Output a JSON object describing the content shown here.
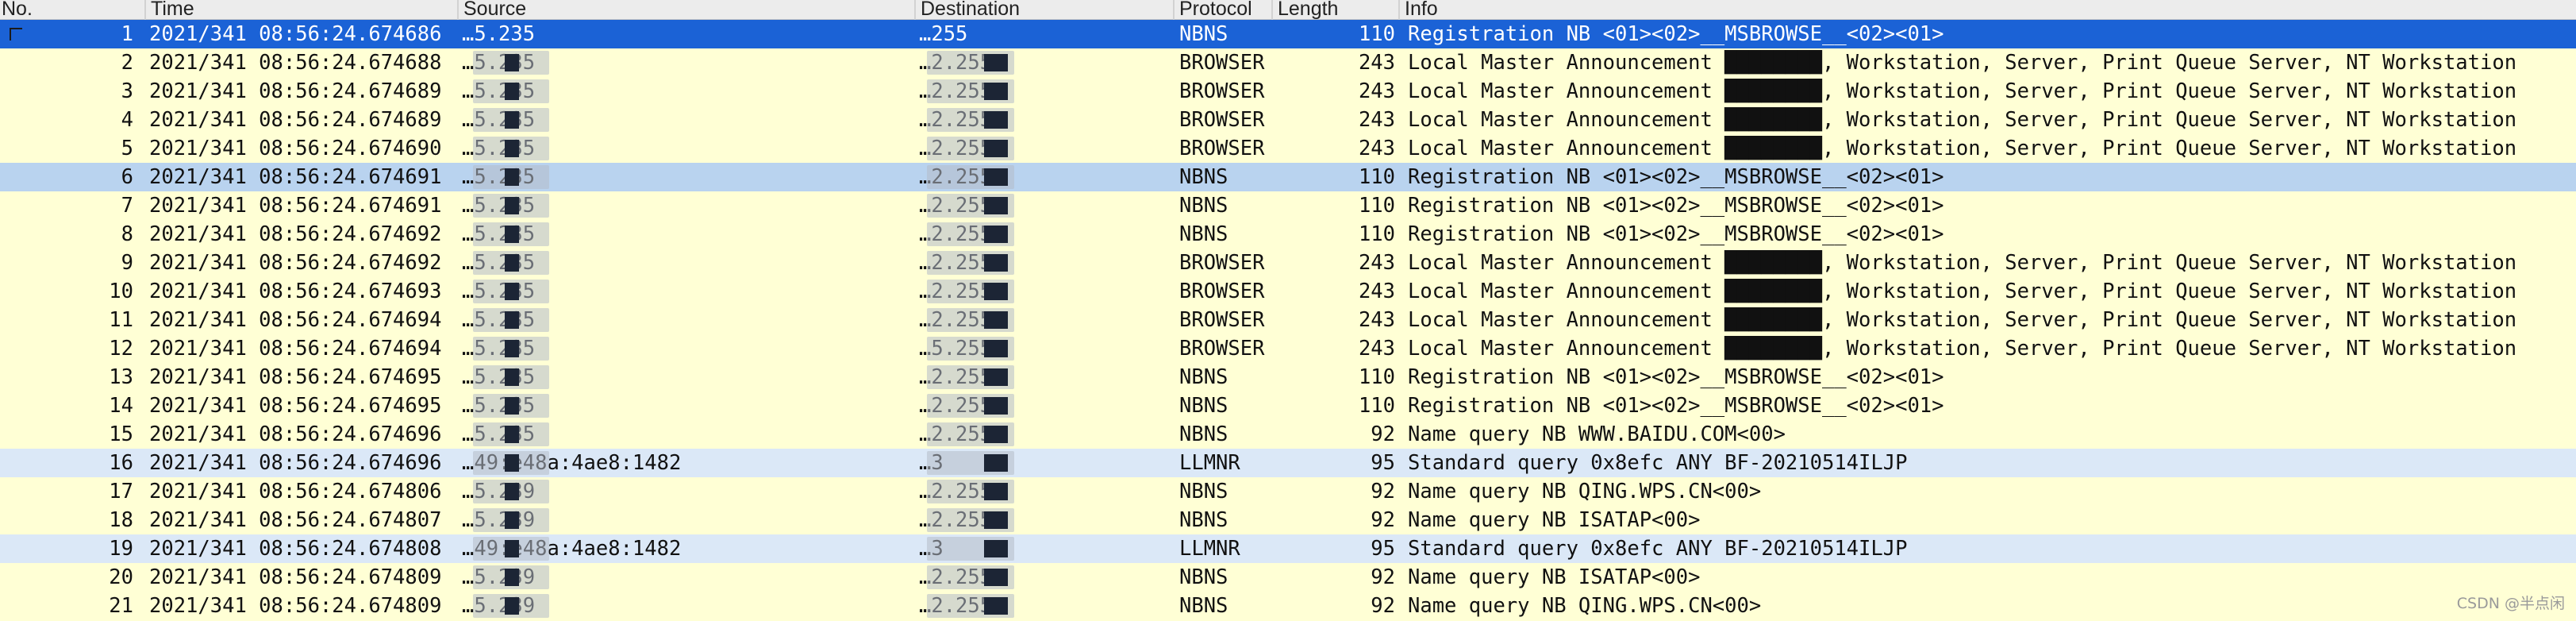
{
  "columns": {
    "no": "No.",
    "time": "Time",
    "source": "Source",
    "destination": "Destination",
    "protocol": "Protocol",
    "length": "Length",
    "info": "Info"
  },
  "packets": [
    {
      "no": "1",
      "time": "2021/341 08:56:24.674686",
      "source": "…5.235",
      "destination": "…255",
      "protocol": "NBNS",
      "length": "110",
      "info": "Registration NB <01><02>__MSBROWSE__<02><01>",
      "state": "selected"
    },
    {
      "no": "2",
      "time": "2021/341 08:56:24.674688",
      "source": "…5.235",
      "destination": "…2.255",
      "protocol": "BROWSER",
      "length": "243",
      "info": "Local Master Announcement ████████, Workstation, Server, Print Queue Server, NT Workstation",
      "state": "normal"
    },
    {
      "no": "3",
      "time": "2021/341 08:56:24.674689",
      "source": "…5.235",
      "destination": "…2.255",
      "protocol": "BROWSER",
      "length": "243",
      "info": "Local Master Announcement ████████, Workstation, Server, Print Queue Server, NT Workstation",
      "state": "normal"
    },
    {
      "no": "4",
      "time": "2021/341 08:56:24.674689",
      "source": "…5.235",
      "destination": "…2.255",
      "protocol": "BROWSER",
      "length": "243",
      "info": "Local Master Announcement ████████, Workstation, Server, Print Queue Server, NT Workstation",
      "state": "normal"
    },
    {
      "no": "5",
      "time": "2021/341 08:56:24.674690",
      "source": "…5.235",
      "destination": "…2.255",
      "protocol": "BROWSER",
      "length": "243",
      "info": "Local Master Announcement ████████, Workstation, Server, Print Queue Server, NT Workstation",
      "state": "normal"
    },
    {
      "no": "6",
      "time": "2021/341 08:56:24.674691",
      "source": "…5.235",
      "destination": "…2.255",
      "protocol": "NBNS",
      "length": "110",
      "info": "Registration NB <01><02>__MSBROWSE__<02><01>",
      "state": "highlighted"
    },
    {
      "no": "7",
      "time": "2021/341 08:56:24.674691",
      "source": "…5.235",
      "destination": "…2.255",
      "protocol": "NBNS",
      "length": "110",
      "info": "Registration NB <01><02>__MSBROWSE__<02><01>",
      "state": "normal"
    },
    {
      "no": "8",
      "time": "2021/341 08:56:24.674692",
      "source": "…5.235",
      "destination": "…2.255",
      "protocol": "NBNS",
      "length": "110",
      "info": "Registration NB <01><02>__MSBROWSE__<02><01>",
      "state": "normal"
    },
    {
      "no": "9",
      "time": "2021/341 08:56:24.674692",
      "source": "…5.235",
      "destination": "…2.255",
      "protocol": "BROWSER",
      "length": "243",
      "info": "Local Master Announcement ████████, Workstation, Server, Print Queue Server, NT Workstation",
      "state": "normal"
    },
    {
      "no": "10",
      "time": "2021/341 08:56:24.674693",
      "source": "…5.235",
      "destination": "…2.255",
      "protocol": "BROWSER",
      "length": "243",
      "info": "Local Master Announcement ████████, Workstation, Server, Print Queue Server, NT Workstation",
      "state": "normal"
    },
    {
      "no": "11",
      "time": "2021/341 08:56:24.674694",
      "source": "…5.235",
      "destination": "…2.255",
      "protocol": "BROWSER",
      "length": "243",
      "info": "Local Master Announcement ████████, Workstation, Server, Print Queue Server, NT Workstation",
      "state": "normal"
    },
    {
      "no": "12",
      "time": "2021/341 08:56:24.674694",
      "source": "…5.235",
      "destination": "…5.255",
      "protocol": "BROWSER",
      "length": "243",
      "info": "Local Master Announcement ████████, Workstation, Server, Print Queue Server, NT Workstation",
      "state": "normal"
    },
    {
      "no": "13",
      "time": "2021/341 08:56:24.674695",
      "source": "…5.235",
      "destination": "…2.255",
      "protocol": "NBNS",
      "length": "110",
      "info": "Registration NB <01><02>__MSBROWSE__<02><01>",
      "state": "normal"
    },
    {
      "no": "14",
      "time": "2021/341 08:56:24.674695",
      "source": "…5.235",
      "destination": "…2.255",
      "protocol": "NBNS",
      "length": "110",
      "info": "Registration NB <01><02>__MSBROWSE__<02><01>",
      "state": "normal"
    },
    {
      "no": "15",
      "time": "2021/341 08:56:24.674696",
      "source": "…5.235",
      "destination": "…2.255",
      "protocol": "NBNS",
      "length": "92",
      "info": "Name query NB WWW.BAIDU.COM<00>",
      "state": "normal"
    },
    {
      "no": "16",
      "time": "2021/341 08:56:24.674696",
      "source": "…49:e48a:4ae8:1482",
      "destination": "…3",
      "protocol": "LLMNR",
      "length": "95",
      "info": "Standard query 0x8efc ANY BF-20210514ILJP",
      "state": "llmnr"
    },
    {
      "no": "17",
      "time": "2021/341 08:56:24.674806",
      "source": "…5.239",
      "destination": "…2.255",
      "protocol": "NBNS",
      "length": "92",
      "info": "Name query NB QING.WPS.CN<00>",
      "state": "normal"
    },
    {
      "no": "18",
      "time": "2021/341 08:56:24.674807",
      "source": "…5.239",
      "destination": "…2.255",
      "protocol": "NBNS",
      "length": "92",
      "info": "Name query NB ISATAP<00>",
      "state": "normal"
    },
    {
      "no": "19",
      "time": "2021/341 08:56:24.674808",
      "source": "…49:e48a:4ae8:1482",
      "destination": "…3",
      "protocol": "LLMNR",
      "length": "95",
      "info": "Standard query 0x8efc ANY BF-20210514ILJP",
      "state": "llmnr"
    },
    {
      "no": "20",
      "time": "2021/341 08:56:24.674809",
      "source": "…5.239",
      "destination": "…2.255",
      "protocol": "NBNS",
      "length": "92",
      "info": "Name query NB ISATAP<00>",
      "state": "normal"
    },
    {
      "no": "21",
      "time": "2021/341 08:56:24.674809",
      "source": "…5.239",
      "destination": "…2.255",
      "protocol": "NBNS",
      "length": "92",
      "info": "Name query NB QING.WPS.CN<00>",
      "state": "normal"
    }
  ],
  "watermark": "CSDN @半点闲",
  "colors": {
    "row_default": "#ffffd5",
    "row_llmnr": "#dbe8f7",
    "row_highlight": "#b9d3ef",
    "row_selected": "#1b62d6",
    "header_bg": "#ececec"
  }
}
